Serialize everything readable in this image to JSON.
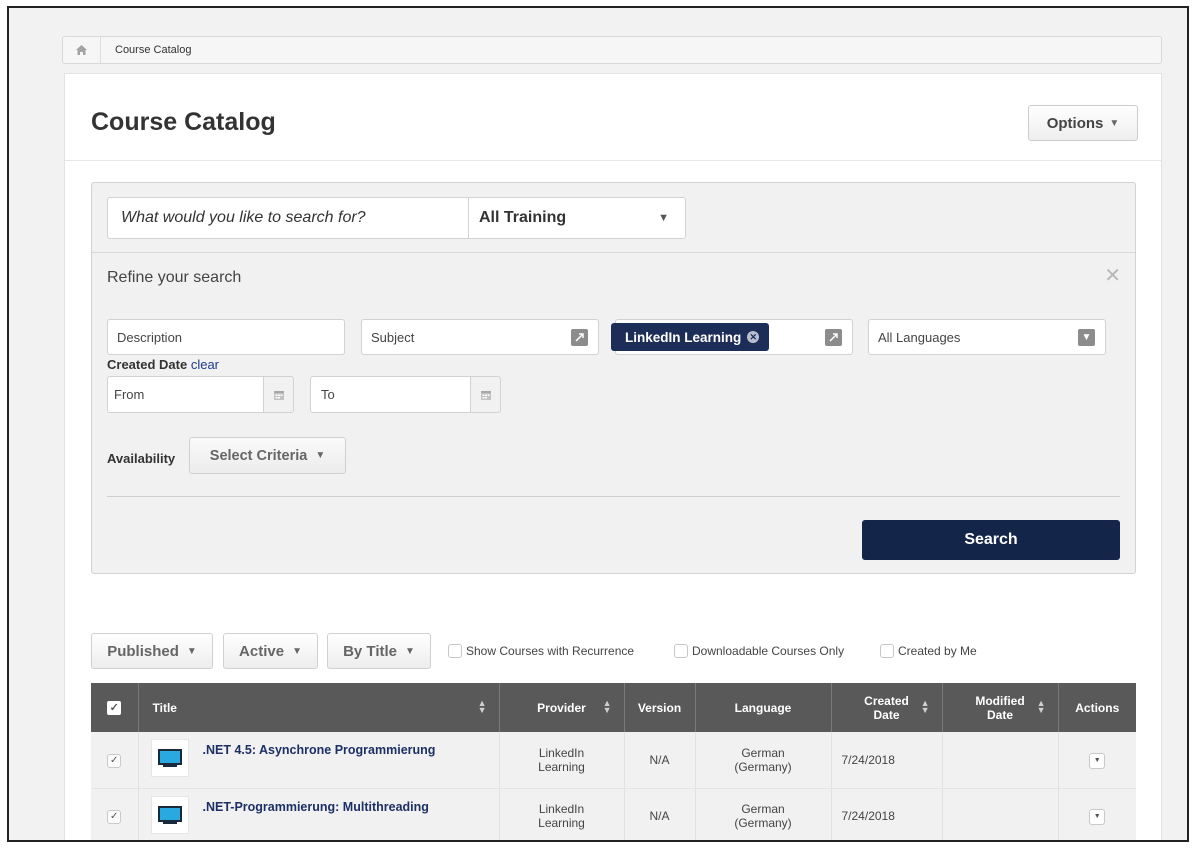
{
  "breadcrumb": {
    "home_icon": "home-icon",
    "current": "Course Catalog"
  },
  "page": {
    "title": "Course Catalog",
    "options_label": "Options"
  },
  "search": {
    "placeholder": "What would you like to search for?",
    "training_type": "All Training",
    "refine_title": "Refine your search",
    "description_placeholder": "Description",
    "subject_placeholder": "Subject",
    "provider_tag": "LinkedIn Learning",
    "language": "All Languages",
    "created_date_label": "Created Date",
    "clear_label": "clear",
    "from_placeholder": "From",
    "to_placeholder": "To",
    "availability_label": "Availability",
    "criteria_label": "Select Criteria",
    "search_button": "Search"
  },
  "filters": {
    "published": "Published",
    "active": "Active",
    "sort": "By Title",
    "recurrence": "Show Courses with Recurrence",
    "downloadable": "Downloadable Courses Only",
    "created_by_me": "Created by Me"
  },
  "table": {
    "headers": {
      "title": "Title",
      "provider": "Provider",
      "version": "Version",
      "language": "Language",
      "created_1": "Created",
      "created_2": "Date",
      "modified_1": "Modified",
      "modified_2": "Date",
      "actions": "Actions"
    },
    "rows": [
      {
        "title": ".NET 4.5: Asynchrone Programmierung",
        "provider_1": "LinkedIn",
        "provider_2": "Learning",
        "version": "N/A",
        "language_1": "German",
        "language_2": "(Germany)",
        "created": "7/24/2018",
        "modified": ""
      },
      {
        "title": ".NET-Programmierung: Multithreading",
        "provider_1": "LinkedIn",
        "provider_2": "Learning",
        "version": "N/A",
        "language_1": "German",
        "language_2": "(Germany)",
        "created": "7/24/2018",
        "modified": ""
      }
    ]
  },
  "colors": {
    "navy": "#14254a",
    "header_gray": "#595959",
    "link_blue": "#1c3066"
  }
}
